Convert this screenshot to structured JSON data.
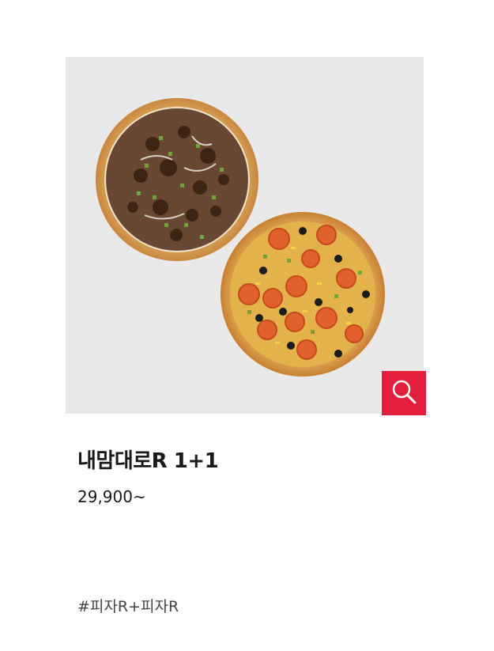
{
  "product": {
    "title": "내맘대로R 1+1",
    "price": "29,900~",
    "hashtag": "#피자R+피자R",
    "image_alt": "pizza-pair"
  },
  "zoom_button": {
    "icon": "magnifier-icon",
    "color": "#e31e3c"
  },
  "colors": {
    "image_background": "#e9e9e9",
    "accent": "#e31e3c",
    "text": "#1a1a1a"
  }
}
